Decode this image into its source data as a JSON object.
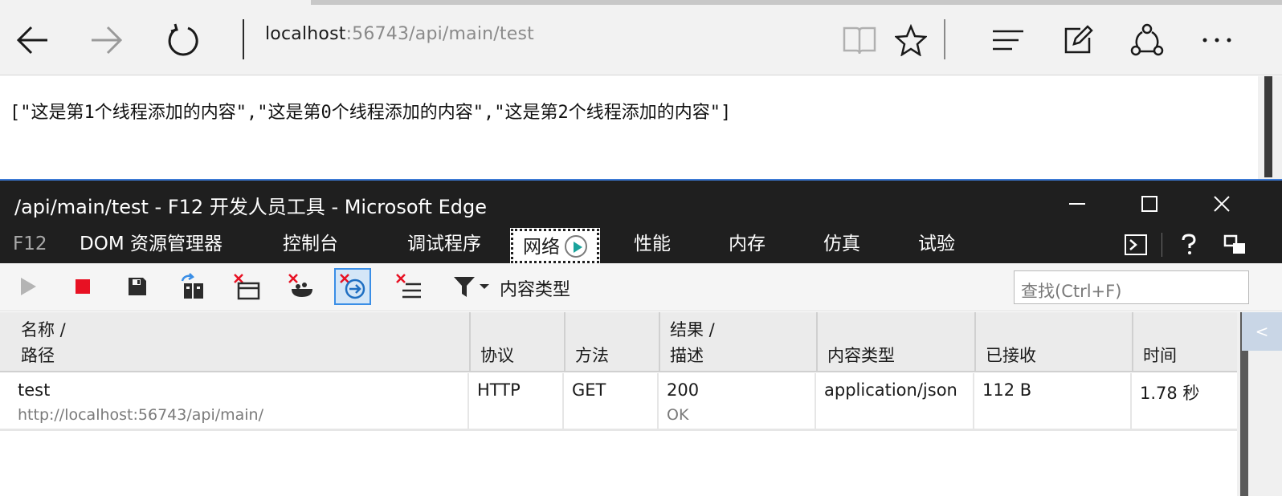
{
  "browser": {
    "url_host": "localhost",
    "url_rest": ":56743/api/main/test"
  },
  "page": {
    "json_text": "[\"这是第1个线程添加的内容\",\"这是第0个线程添加的内容\",\"这是第2个线程添加的内容\"]"
  },
  "devtools": {
    "title": "/api/main/test - F12 开发人员工具 - Microsoft Edge",
    "tabs": [
      "F12",
      "DOM 资源管理器",
      "控制台",
      "调试程序",
      "网络",
      "性能",
      "内存",
      "仿真",
      "试验"
    ],
    "active_tab": "网络",
    "toolbar": {
      "filter_label": "内容类型",
      "search_placeholder": "查找(Ctrl+F)"
    },
    "columns": [
      {
        "line1": "名称 /",
        "line2": "路径"
      },
      {
        "line1": "",
        "line2": "协议"
      },
      {
        "line1": "",
        "line2": "方法"
      },
      {
        "line1": "结果 /",
        "line2": "描述"
      },
      {
        "line1": "",
        "line2": "内容类型"
      },
      {
        "line1": "",
        "line2": "已接收"
      },
      {
        "line1": "",
        "line2": "时间"
      }
    ],
    "rows": [
      {
        "name": "test",
        "path": "http://localhost:56743/api/main/",
        "protocol": "HTTP",
        "method": "GET",
        "result": "200",
        "description": "OK",
        "content_type": "application/json",
        "received": "112 B",
        "time": "1.78 秒"
      }
    ],
    "collapse_glyph": "<"
  },
  "colors": {
    "accent": "#3a8ee6",
    "stop": "#e81123",
    "error_x": "#e81123",
    "play_teal": "#1aa39c",
    "devtools_dark": "#1f1f1f"
  }
}
